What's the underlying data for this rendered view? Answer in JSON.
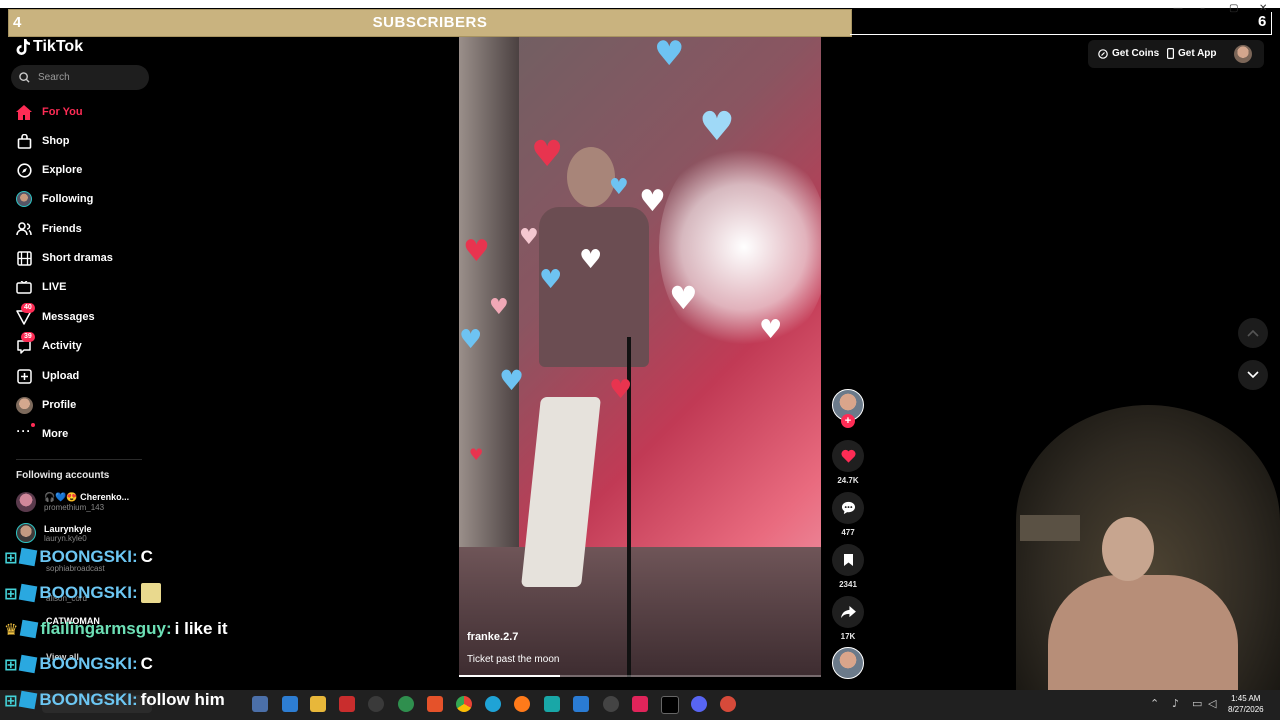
{
  "overlay": {
    "left_count": "4",
    "title": "SUBSCRIBERS",
    "right_count": "6"
  },
  "window": {
    "minimize": "—",
    "maximize": "▢",
    "close": "✕"
  },
  "sidebar": {
    "logo": "TikTok",
    "search_placeholder": "Search",
    "nav": [
      {
        "label": "For You",
        "icon": "home-icon",
        "active": true
      },
      {
        "label": "Shop",
        "icon": "shop-icon"
      },
      {
        "label": "Explore",
        "icon": "compass-icon"
      },
      {
        "label": "Following",
        "icon": "following-avatar-icon"
      },
      {
        "label": "Friends",
        "icon": "friends-icon"
      },
      {
        "label": "Short dramas",
        "icon": "film-icon"
      },
      {
        "label": "LIVE",
        "icon": "live-icon"
      },
      {
        "label": "Messages",
        "icon": "messages-icon",
        "badge": "40"
      },
      {
        "label": "Activity",
        "icon": "activity-icon",
        "badge": "39"
      },
      {
        "label": "Upload",
        "icon": "upload-icon"
      },
      {
        "label": "Profile",
        "icon": "profile-avatar-icon"
      },
      {
        "label": "More",
        "icon": "more-icon"
      }
    ],
    "following_heading": "Following accounts",
    "accounts": [
      {
        "name": "🎧💙😍 Cherenko...",
        "handle": "promethium_143"
      },
      {
        "name": "Laurynkyle",
        "handle": "lauryn.kyle0"
      },
      {
        "name": "",
        "handle": "sophiabroadcast"
      },
      {
        "name": "",
        "handle": "alison_cord"
      },
      {
        "name": "CATWOMAN",
        "handle": ""
      }
    ],
    "view_all": "View all"
  },
  "video": {
    "username": "franke.2.7",
    "caption": "Ticket past the moon",
    "progress": 0.28
  },
  "actions": {
    "likes": "24.7K",
    "comments": "477",
    "saves": "2341",
    "shares": "17K"
  },
  "topbar": {
    "get_coins": "Get Coins",
    "get_app": "Get App"
  },
  "chat": [
    {
      "user": "BOONGSKI:",
      "message": "C"
    },
    {
      "user": "BOONGSKI:",
      "message": ""
    },
    {
      "user": "flailingarmsguy:",
      "message": "i like it"
    },
    {
      "user": "BOONGSKI:",
      "message": "C"
    },
    {
      "user": "BOONGSKI:",
      "message": "follow him"
    }
  ],
  "taskbar": {
    "time": "1:45 AM",
    "date": "8/27/2026"
  },
  "colors": {
    "accent": "#fe2c55",
    "overlay_bar": "#c9b37f",
    "chat_user": "#6cc6f2",
    "chat_user_alt": "#6de0b6"
  }
}
